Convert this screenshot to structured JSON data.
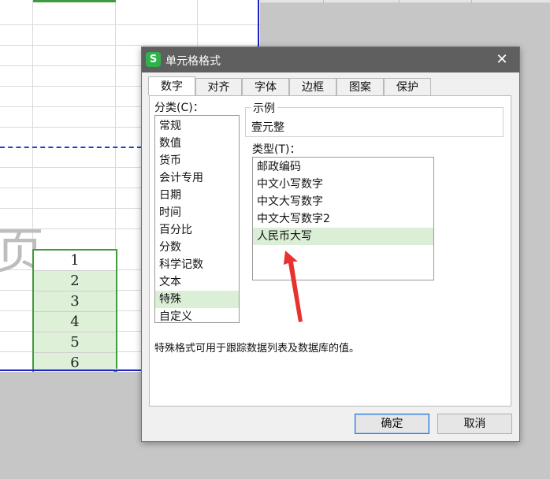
{
  "sheet": {
    "background_char": "页",
    "selected_values": [
      "1",
      "2",
      "3",
      "4",
      "5",
      "6"
    ]
  },
  "dialog": {
    "title": "单元格格式",
    "app_icon_letter": "S",
    "close_glyph": "✕",
    "tabs": [
      {
        "label": "数字",
        "active": true
      },
      {
        "label": "对齐",
        "active": false
      },
      {
        "label": "字体",
        "active": false
      },
      {
        "label": "边框",
        "active": false
      },
      {
        "label": "图案",
        "active": false
      },
      {
        "label": "保护",
        "active": false
      }
    ],
    "category_label": "分类(C)：",
    "categories": [
      "常规",
      "数值",
      "货币",
      "会计专用",
      "日期",
      "时间",
      "百分比",
      "分数",
      "科学记数",
      "文本",
      "特殊",
      "自定义"
    ],
    "selected_category": "特殊",
    "sample_legend": "示例",
    "sample_value": "壹元整",
    "type_label": "类型(T)：",
    "types": [
      "邮政编码",
      "中文小写数字",
      "中文大写数字",
      "中文大写数字2",
      "人民币大写"
    ],
    "selected_type": "人民币大写",
    "description": "特殊格式可用于跟踪数据列表及数据库的值。",
    "ok_label": "确定",
    "cancel_label": "取消"
  },
  "colors": {
    "selection_green": "#3e9b3e",
    "selected_item_bg": "#dbeed6",
    "titlebar": "#5f5f5f",
    "annotation_arrow": "#e8322d",
    "page_break_blue": "#1a24c8"
  }
}
